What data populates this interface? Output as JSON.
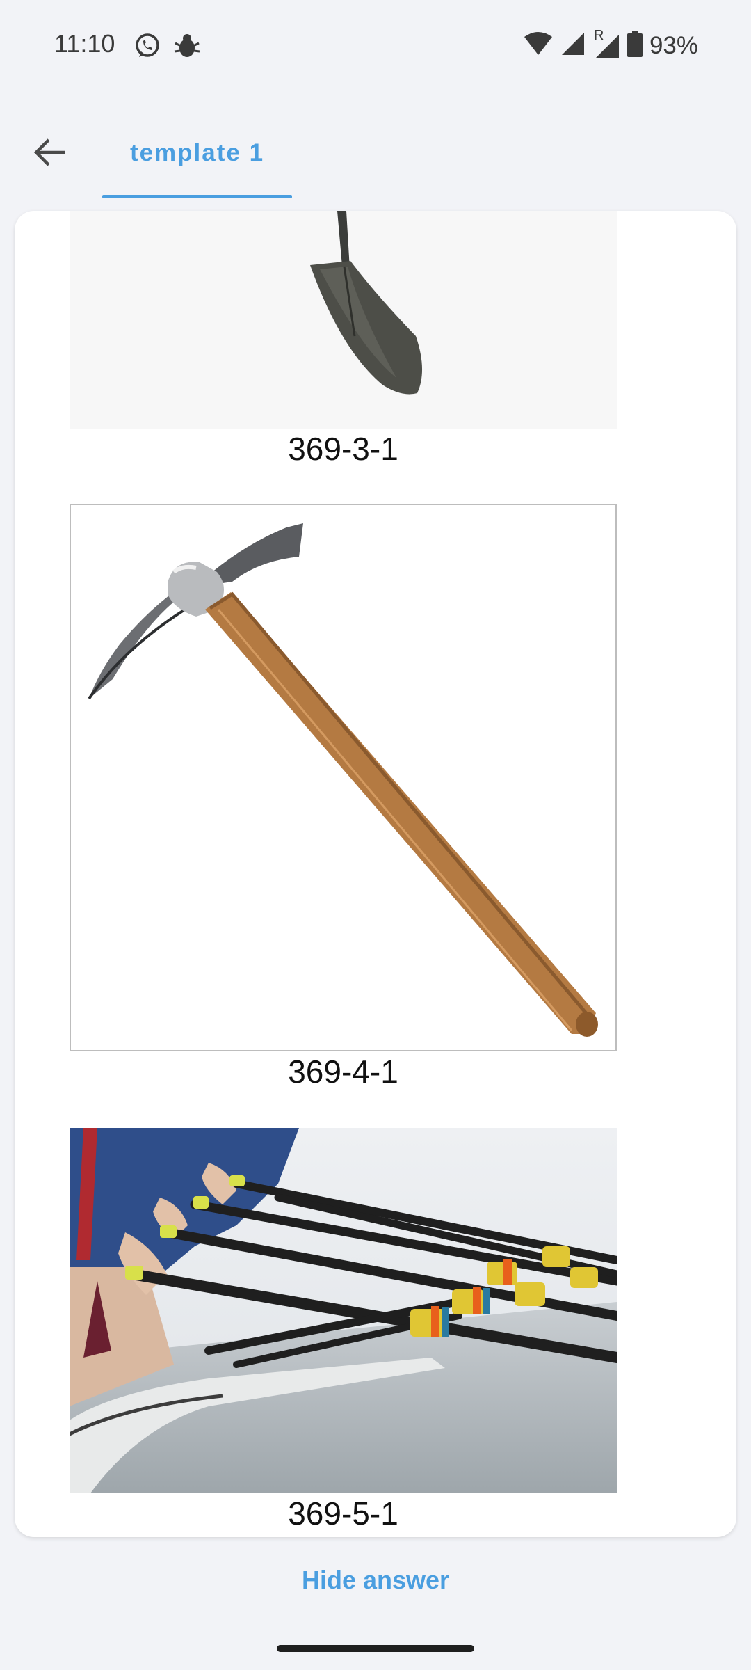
{
  "status_bar": {
    "time": "11:10",
    "notification_icons": [
      "whatsapp-icon",
      "bug-icon"
    ],
    "system_icons": [
      "wifi-icon",
      "signal-icon",
      "roaming-signal-icon",
      "battery-icon"
    ],
    "roaming_label": "R",
    "battery": "93%"
  },
  "toolbar": {
    "back_icon": "arrow-left-icon",
    "tab_label": "template 1"
  },
  "card": {
    "figures": [
      {
        "image": "shovel",
        "caption": "369-3-1"
      },
      {
        "image": "pickaxe",
        "caption": "369-4-1"
      },
      {
        "image": "rowing-crew",
        "caption": "369-5-1"
      }
    ]
  },
  "footer": {
    "hide_answer_label": "Hide answer"
  },
  "colors": {
    "accent": "#4a9ee0",
    "background": "#f2f3f7",
    "card": "#ffffff"
  }
}
